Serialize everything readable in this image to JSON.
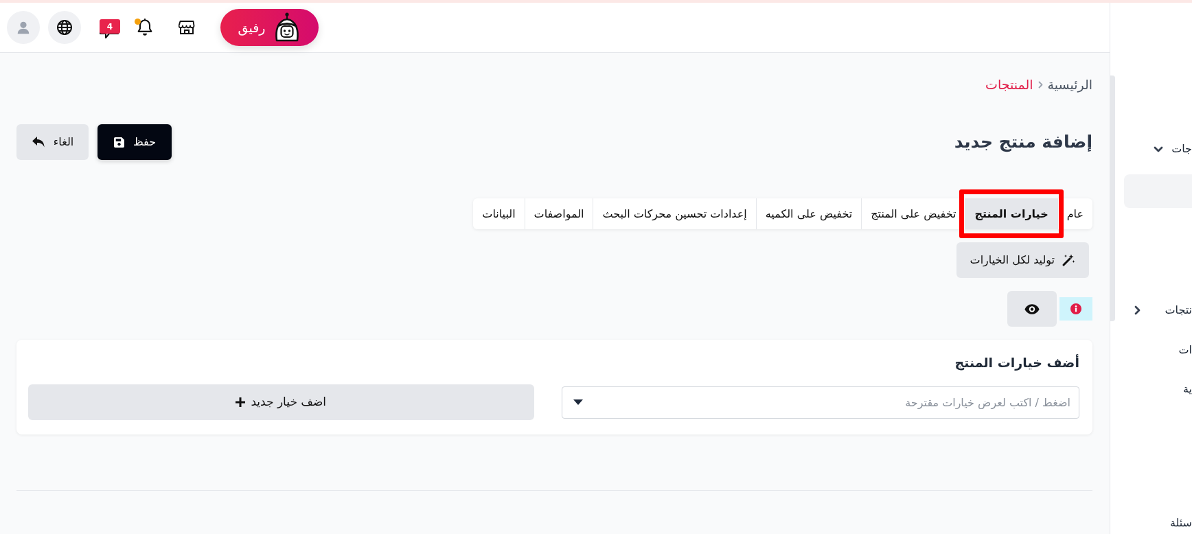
{
  "header": {
    "assistant": {
      "label": "رفيق"
    },
    "messages": {
      "badge": "4"
    },
    "notifications": {
      "unread": true
    }
  },
  "sidebar": {
    "items": [
      {
        "kind": "group",
        "label": "جات",
        "expanded": true,
        "children": [
          {
            "selected": true
          }
        ]
      },
      {
        "kind": "group",
        "label": "نتجات",
        "expanded": false
      },
      {
        "kind": "link",
        "label": "ات"
      },
      {
        "kind": "link",
        "label": "ية"
      },
      {
        "kind": "link",
        "label": "سئلة"
      }
    ]
  },
  "breadcrumb": [
    {
      "label": "الرئيسية",
      "current": false
    },
    {
      "label": "المنتجات",
      "current": true
    }
  ],
  "title": "إضافة منتج جديد",
  "actions": [
    {
      "kind": "save",
      "label": "حفظ"
    },
    {
      "kind": "cancel",
      "label": "الغاء"
    }
  ],
  "tabs": [
    {
      "label": "عام",
      "selected": false,
      "highlighted": false
    },
    {
      "label": "خيارات المنتج",
      "selected": true,
      "highlighted": true
    },
    {
      "label": "تخفيض على المنتج",
      "selected": false,
      "highlighted": false
    },
    {
      "label": "تخفيض على الكميه",
      "selected": false,
      "highlighted": false
    },
    {
      "label": "إعدادات تحسين محركات البحث",
      "selected": false,
      "highlighted": false
    },
    {
      "label": "المواصفات",
      "selected": false,
      "highlighted": false
    },
    {
      "label": "البيانات",
      "selected": false,
      "highlighted": false
    }
  ],
  "toolbar": {
    "generate_button": {
      "label": "توليد لكل الخيارات"
    }
  },
  "options_card": {
    "title": "أضف خيارات المنتج",
    "select": {
      "placeholder": "اضغط / اكتب لعرض خيارات مقترحة"
    },
    "add_button": {
      "label": "اضف خيار جديد"
    }
  }
}
